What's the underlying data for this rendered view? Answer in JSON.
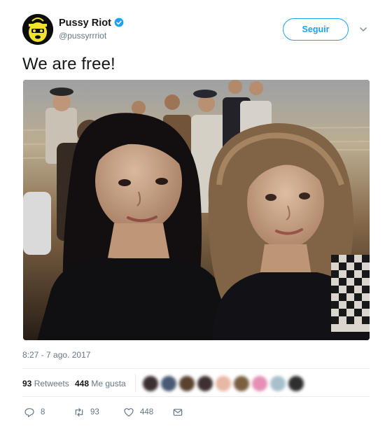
{
  "user": {
    "display_name": "Pussy Riot",
    "handle": "@pussyrrriot",
    "verified": true,
    "avatar_icon": "balaclava-face-icon",
    "avatar_colors": {
      "background": "#0c0c0c",
      "face": "#f2e22b"
    }
  },
  "follow_button": {
    "label": "Seguir"
  },
  "more_menu_icon": "chevron-down-icon",
  "tweet": {
    "text": "We are free!",
    "photo": {
      "description_icon": "photo"
    },
    "timestamp": "8:27 - 7 ago. 2017"
  },
  "stats": {
    "retweets_count": "93",
    "retweets_label": "Retweets",
    "likes_count": "448",
    "likes_label": "Me gusta",
    "likers": [
      {
        "color": "#3b2f2f"
      },
      {
        "color": "#4a5a75"
      },
      {
        "color": "#5a4230"
      },
      {
        "color": "#3d3030"
      },
      {
        "color": "#e8b7a5"
      },
      {
        "color": "#7a6040"
      },
      {
        "color": "#e58fb5"
      },
      {
        "color": "#a8c0cc"
      },
      {
        "color": "#2f2f2f"
      }
    ]
  },
  "actions": {
    "reply": {
      "icon": "reply-icon",
      "count": "8"
    },
    "retweet": {
      "icon": "retweet-icon",
      "count": "93"
    },
    "like": {
      "icon": "heart-icon",
      "count": "448"
    },
    "message": {
      "icon": "envelope-icon"
    }
  },
  "colors": {
    "accent": "#1da1f2",
    "text": "#14171a",
    "muted": "#657786"
  }
}
